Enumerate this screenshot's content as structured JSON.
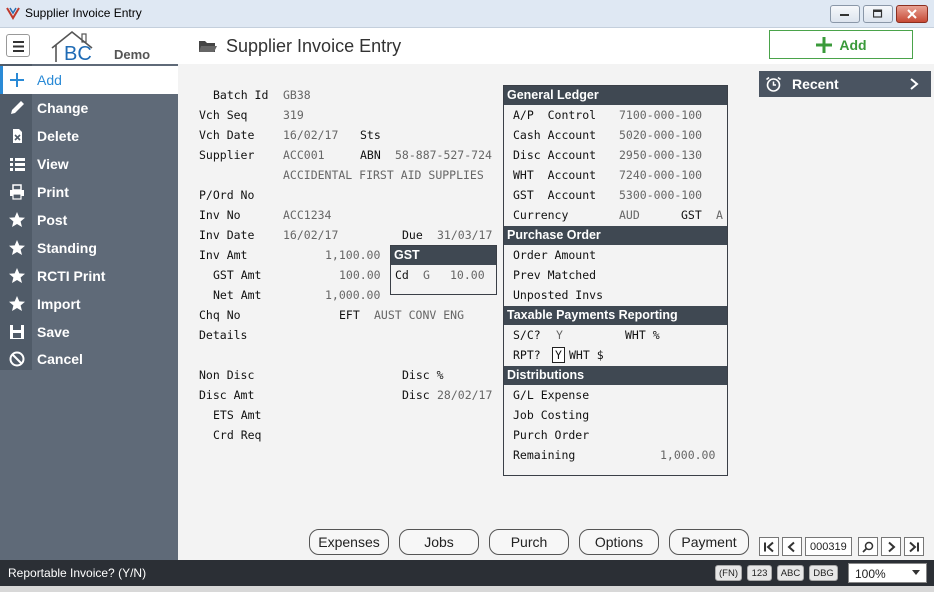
{
  "window": {
    "title": "Supplier Invoice Entry"
  },
  "header": {
    "demo_label": "Demo",
    "logo_text": "BC",
    "page_title": "Supplier Invoice Entry",
    "add_label": "Add"
  },
  "sidebar": {
    "items": [
      {
        "label": "Add",
        "icon": "plus-icon"
      },
      {
        "label": "Change",
        "icon": "pencil-icon"
      },
      {
        "label": "Delete",
        "icon": "delete-icon"
      },
      {
        "label": "View",
        "icon": "list-icon"
      },
      {
        "label": "Print",
        "icon": "printer-icon"
      },
      {
        "label": "Post",
        "icon": "star-icon"
      },
      {
        "label": "Standing",
        "icon": "star-icon"
      },
      {
        "label": "RCTI Print",
        "icon": "star-icon"
      },
      {
        "label": "Import",
        "icon": "star-icon"
      },
      {
        "label": "Save",
        "icon": "save-icon"
      },
      {
        "label": "Cancel",
        "icon": "cancel-icon"
      }
    ]
  },
  "form": {
    "batch_id_label": "Batch Id",
    "batch_id": "GB38",
    "vch_seq_label": "Vch Seq",
    "vch_seq": "319",
    "vch_date_label": "Vch Date",
    "vch_date": "16/02/17",
    "sts_label": "Sts",
    "supplier_label": "Supplier",
    "supplier_code": "ACC001",
    "abn_label": "ABN",
    "abn": "58-887-527-724",
    "supplier_name": "ACCIDENTAL FIRST AID SUPPLIES",
    "pord_label": "P/Ord No",
    "inv_no_label": "Inv No",
    "inv_no": "ACC1234",
    "inv_date_label": "Inv Date",
    "inv_date": "16/02/17",
    "due_label": "Due",
    "due": "31/03/17",
    "inv_amt_label": "Inv Amt",
    "inv_amt": "1,100.00",
    "gst_amt_label": "GST Amt",
    "gst_amt": "100.00",
    "net_amt_label": "Net Amt",
    "net_amt": "1,000.00",
    "chq_no_label": "Chq No",
    "eft_label": "EFT",
    "eft": "AUST CONV ENG",
    "details_label": "Details",
    "non_disc_label": "Non Disc",
    "disc_pct_label": "Disc %",
    "disc_amt_label": "Disc Amt",
    "disc_label": "Disc",
    "disc_date": "28/02/17",
    "ets_amt_label": "ETS Amt",
    "crd_req_label": "Crd Req"
  },
  "gst_box": {
    "title": "GST",
    "cd_label": "Cd",
    "cd": "G",
    "amount": "10.00"
  },
  "general_ledger": {
    "title": "General Ledger",
    "rows": [
      {
        "label": "A/P  Control",
        "value": "7100-000-100"
      },
      {
        "label": "Cash Account",
        "value": "5020-000-100"
      },
      {
        "label": "Disc Account",
        "value": "2950-000-130"
      },
      {
        "label": "WHT  Account",
        "value": "7240-000-100"
      },
      {
        "label": "GST  Account",
        "value": "5300-000-100"
      }
    ],
    "currency_label": "Currency",
    "currency": "AUD",
    "gst_label": "GST",
    "gst": "A"
  },
  "purchase_order": {
    "title": "Purchase Order",
    "rows": [
      "Order Amount",
      "Prev Matched",
      "Unposted Invs"
    ]
  },
  "taxable": {
    "title": "Taxable Payments Reporting",
    "sc_label": "S/C?",
    "sc": "Y",
    "wht_pct_label": "WHT %",
    "rpt_label": "RPT?",
    "rpt": "Y",
    "wht_dollar_label": "WHT $"
  },
  "distributions": {
    "title": "Distributions",
    "rows": [
      "G/L Expense",
      "Job Costing",
      "Purch Order"
    ],
    "remaining_label": "Remaining",
    "remaining": "1,000.00"
  },
  "recent": {
    "label": "Recent"
  },
  "bottom_buttons": [
    "Expenses",
    "Jobs",
    "Purch",
    "Options",
    "Payment"
  ],
  "record_no": "000319",
  "statusbar": {
    "text": "Reportable Invoice? (Y/N)",
    "badges": [
      "(FN)",
      "123",
      "ABC",
      "DBG"
    ],
    "zoom": "100%"
  },
  "colors": {
    "sidebar": "#5f6a78",
    "accent": "#2a8ad6",
    "panel_head": "#3f4852",
    "add_green": "#3a9a3a"
  }
}
